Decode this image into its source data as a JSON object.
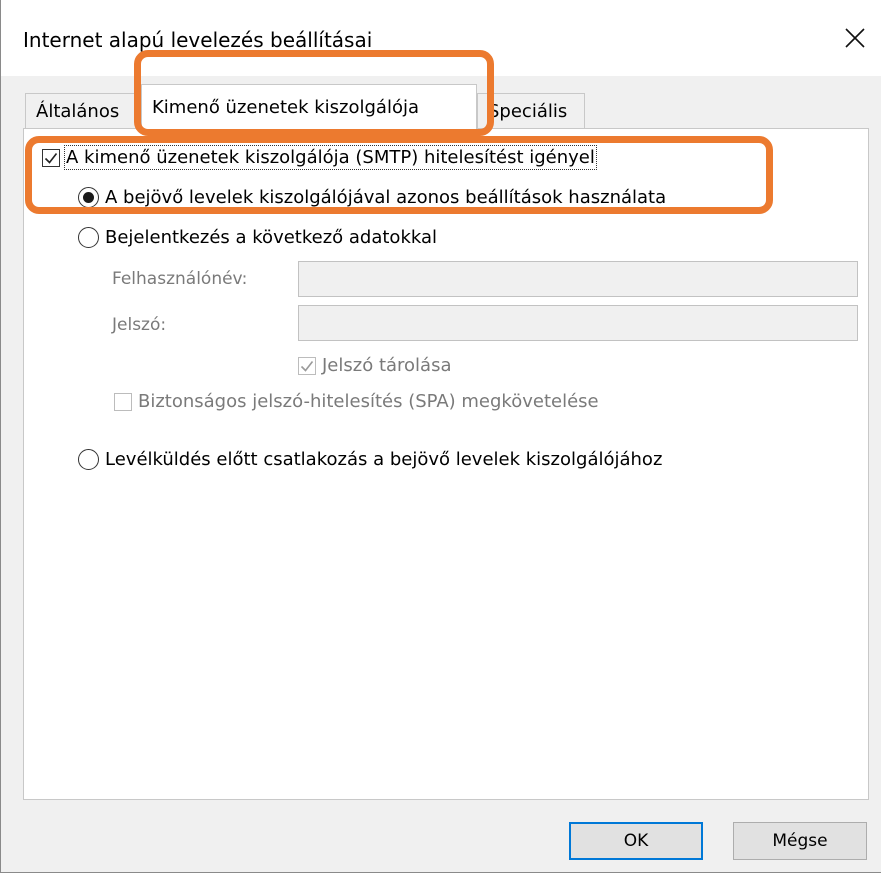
{
  "window": {
    "title": "Internet alapú levelezés beállításai"
  },
  "tabs": {
    "general": "Általános",
    "outgoing": "Kimenő üzenetek kiszolgálója",
    "advanced": "Speciális"
  },
  "panel": {
    "smtp_auth_checkbox": {
      "label": "A kimenő üzenetek kiszolgálója (SMTP) hitelesítést igényel",
      "checked": true
    },
    "radio_same_settings": {
      "label": "A bejövő levelek kiszolgálójával azonos beállítások használata",
      "selected": true
    },
    "radio_login": {
      "label": "Bejelentkezés a következő adatokkal",
      "selected": false
    },
    "username_label": "Felhasználónév:",
    "username_value": "",
    "password_label": "Jelszó:",
    "password_value": "",
    "remember_password": {
      "label": "Jelszó tárolása",
      "checked": true
    },
    "spa": {
      "label": "Biztonságos jelszó-hitelesítés (SPA) megkövetelése",
      "checked": false
    },
    "radio_connect_incoming": {
      "label": "Levélküldés előtt csatlakozás a bejövő levelek kiszolgálójához",
      "selected": false
    }
  },
  "buttons": {
    "ok": "OK",
    "cancel": "Mégse"
  },
  "colors": {
    "highlight": "#ec7a2f",
    "default_button_border": "#0078d7"
  }
}
